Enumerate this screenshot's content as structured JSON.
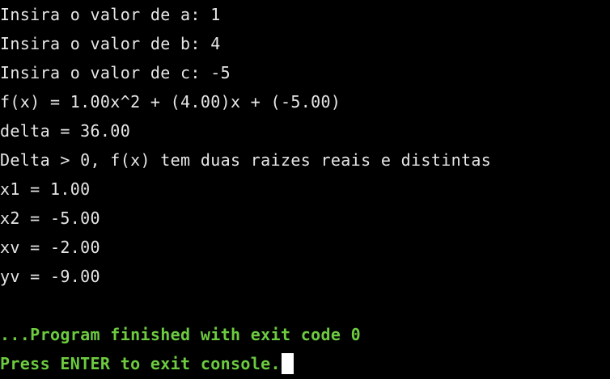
{
  "colors": {
    "background": "#000000",
    "text": "#e6e6e6",
    "status_text": "#6ccb3f",
    "cursor": "#ffffff"
  },
  "console": {
    "output_lines": [
      "Insira o valor de a: 1",
      "Insira o valor de b: 4",
      "Insira o valor de c: -5",
      "f(x) = 1.00x^2 + (4.00)x + (-5.00)",
      "delta = 36.00",
      "Delta > 0, f(x) tem duas raizes reais e distintas",
      "x1 = 1.00",
      "x2 = -5.00",
      "xv = -2.00",
      "yv = -9.00"
    ],
    "finished_message": "...Program finished with exit code 0",
    "exit_prompt": "Press ENTER to exit console."
  }
}
